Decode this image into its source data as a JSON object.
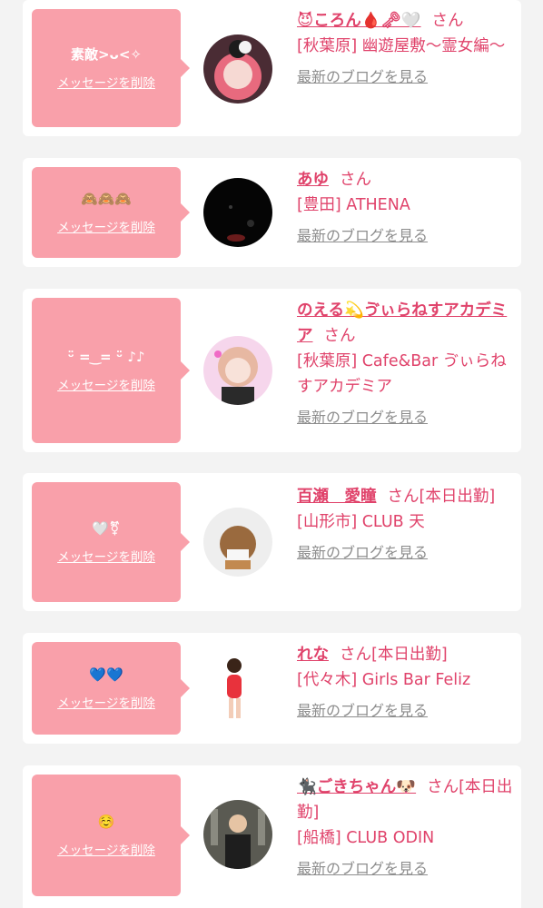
{
  "cards": [
    {
      "message": "素敵>ᴗ<✧",
      "delete_label": "メッセージを削除",
      "name": "😈ころん🩸🗝🤍",
      "san": "さん",
      "status": "",
      "shop": "[秋葉原] 幽遊屋敷〜霊女編〜",
      "blog_label": "最新のブログを見る"
    },
    {
      "message": "🙈🙈🙈",
      "delete_label": "メッセージを削除",
      "name": "あゆ",
      "san": "さん",
      "status": "",
      "shop": "[豊田] ATHENA",
      "blog_label": "最新のブログを見る"
    },
    {
      "message": "ᵕ̈ = ͜ = ᵕ̈ ♪♪",
      "delete_label": "メッセージを削除",
      "name": "のえる💫ゔぃらねすアカデミア",
      "san": "さん",
      "status": "",
      "shop": "[秋葉原] Cafe&Bar ゔぃらねすアカデミア",
      "blog_label": "最新のブログを見る"
    },
    {
      "message": "🤍⚧",
      "delete_label": "メッセージを削除",
      "name": "百瀬　愛瞳",
      "san": "さん",
      "status": "[本日出勤]",
      "shop": "[山形市] CLUB 天",
      "blog_label": "最新のブログを見る"
    },
    {
      "message": "💙💙",
      "delete_label": "メッセージを削除",
      "name": "れな",
      "san": "さん",
      "status": "[本日出勤]",
      "shop": "[代々木] Girls Bar Feliz",
      "blog_label": "最新のブログを見る"
    },
    {
      "message": "☺️",
      "delete_label": "メッセージを削除",
      "name": "🐈‍⬛ごきちゃん🐶",
      "san": "さん",
      "status": "[本日出勤]",
      "shop": "[船橋] CLUB ODIN",
      "blog_label": "最新のブログを見る"
    }
  ],
  "colors": {
    "accent": "#e0436b",
    "bubble": "#f9a0aa",
    "link_gray": "#8d8d8d",
    "background": "#f3f3f3"
  }
}
